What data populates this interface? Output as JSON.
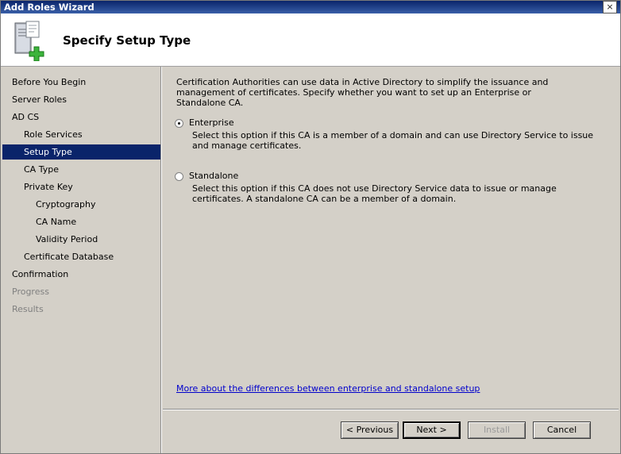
{
  "window": {
    "title": "Add Roles Wizard",
    "close_glyph": "×"
  },
  "header": {
    "title": "Specify Setup Type",
    "icon": "server-add-role-icon"
  },
  "nav": {
    "items": [
      {
        "label": "Before You Begin"
      },
      {
        "label": "Server Roles"
      },
      {
        "label": "AD CS"
      },
      {
        "label": "Role Services"
      },
      {
        "label": "Setup Type"
      },
      {
        "label": "CA Type"
      },
      {
        "label": "Private Key"
      },
      {
        "label": "Cryptography"
      },
      {
        "label": "CA Name"
      },
      {
        "label": "Validity Period"
      },
      {
        "label": "Certificate Database"
      },
      {
        "label": "Confirmation"
      },
      {
        "label": "Progress"
      },
      {
        "label": "Results"
      }
    ],
    "selected": "Setup Type"
  },
  "content": {
    "description": "Certification Authorities can use data in Active Directory to simplify the issuance and management of certificates. Specify whether you want to set up an Enterprise or Standalone CA.",
    "options": [
      {
        "label": "Enterprise",
        "checked": true,
        "description": "Select this option if this CA is a member of a domain and can use Directory Service to issue and manage certificates."
      },
      {
        "label": "Standalone",
        "checked": false,
        "description": "Select this option if this CA does not use Directory Service data to issue or manage certificates. A standalone CA can be a member of a domain."
      }
    ],
    "more_link": "More about the differences between enterprise and standalone setup"
  },
  "buttons": {
    "previous": "< Previous",
    "next": "Next >",
    "install": "Install",
    "cancel": "Cancel"
  },
  "colors": {
    "selection": "#0a246a",
    "link": "#0000cc",
    "accent_plus": "#3cb43c"
  }
}
